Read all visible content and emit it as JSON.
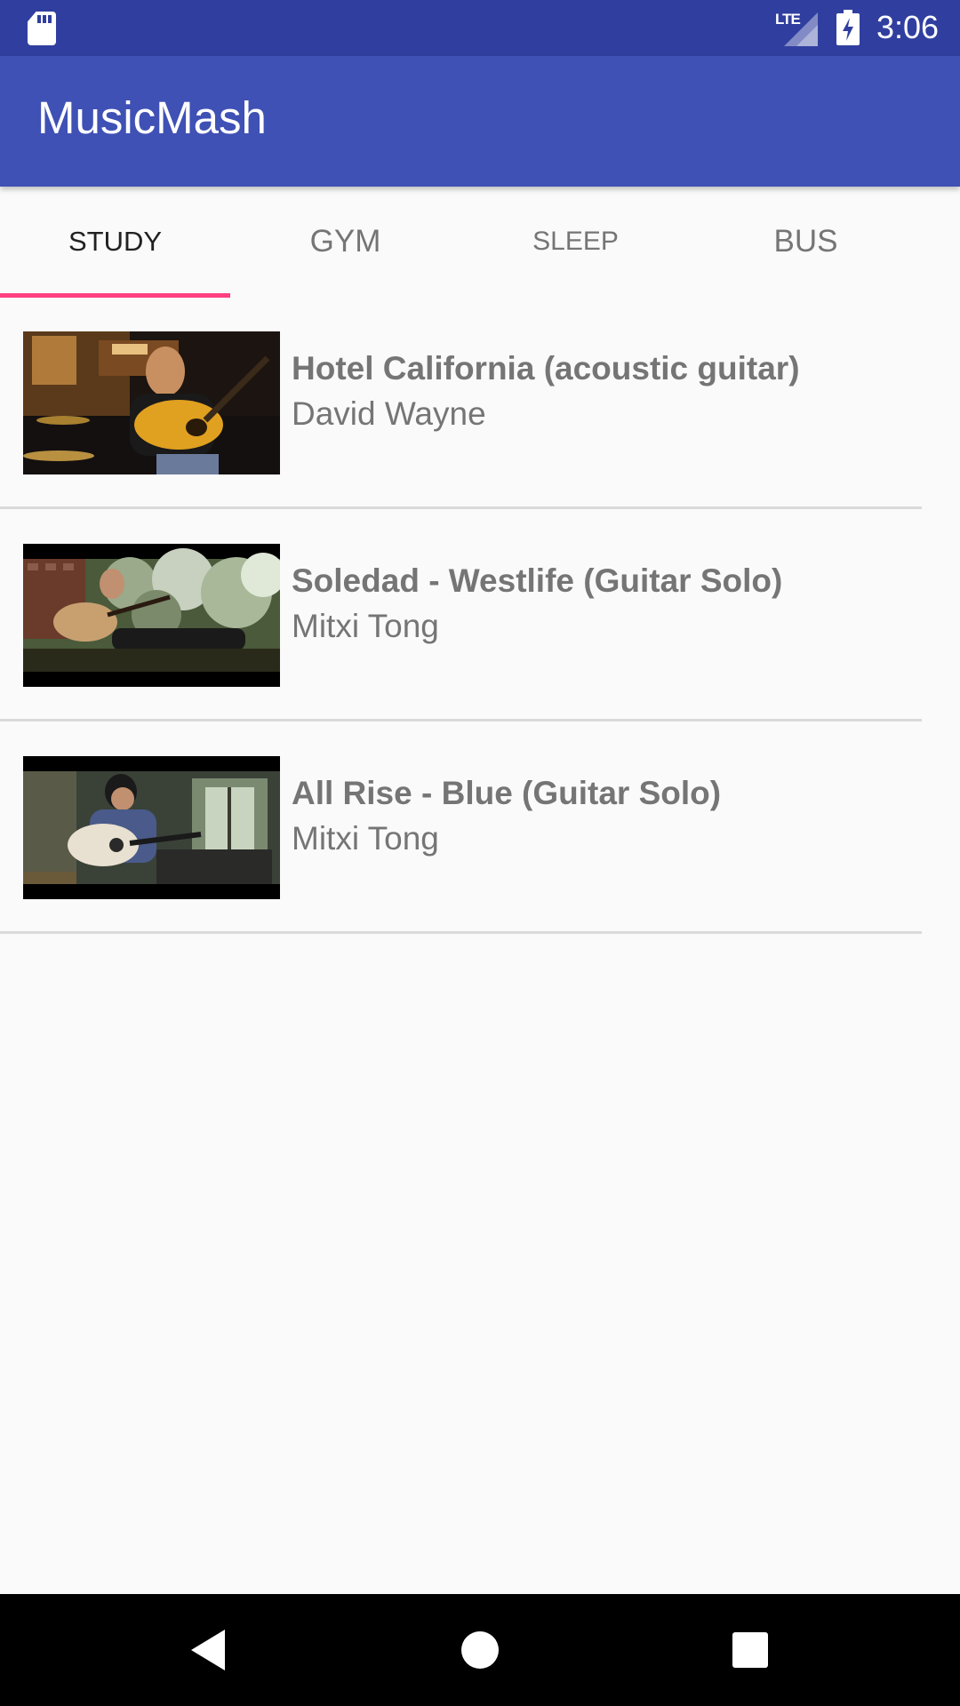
{
  "status_bar": {
    "network": "LTE",
    "time": "3:06"
  },
  "app": {
    "title": "MusicMash"
  },
  "colors": {
    "status_bar": "#303f9f",
    "primary": "#3f51b5",
    "accent": "#ff4081"
  },
  "tabs": [
    {
      "label": "Study",
      "selected": true
    },
    {
      "label": "Gym",
      "selected": false
    },
    {
      "label": "Sleep",
      "selected": false
    },
    {
      "label": "Bus",
      "selected": false
    }
  ],
  "videos": [
    {
      "title": "Hotel California (acoustic guitar)",
      "artist": "David Wayne"
    },
    {
      "title": "Soledad - Westlife (Guitar Solo)",
      "artist": "Mitxi Tong"
    },
    {
      "title": "All Rise - Blue (Guitar Solo)",
      "artist": "Mitxi Tong"
    }
  ],
  "icons": {
    "sd_card": "sd-card-icon",
    "signal": "signal-icon",
    "battery": "battery-charging-icon",
    "back": "back-icon",
    "home": "home-icon",
    "recents": "recents-icon"
  }
}
